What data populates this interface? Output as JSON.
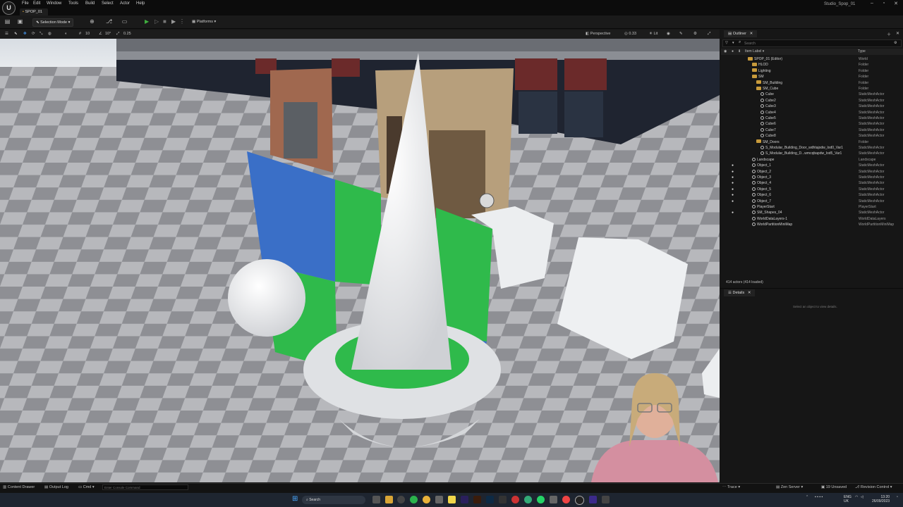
{
  "app": {
    "menu": [
      "File",
      "Edit",
      "Window",
      "Tools",
      "Build",
      "Select",
      "Actor",
      "Help"
    ],
    "project_title": "Studio_Spop_01",
    "level_tab": "SPOP_01"
  },
  "toolbar": {
    "selection_mode": "Selection Mode",
    "platforms": "Platforms"
  },
  "viewport": {
    "perspective": "Perspective",
    "fov_value": "0.33",
    "lit": "Lit",
    "grid_snap": "10",
    "rotation_snap": "10°",
    "scale_snap": "0.25"
  },
  "outliner": {
    "tab": "Outliner",
    "search_placeholder": "Search",
    "col_label": "Item Label ▾",
    "col_type": "Type",
    "rows": [
      {
        "label": "SPOP_01 (Editor)",
        "type": "World",
        "indent": 0,
        "kind": "world",
        "eye": false
      },
      {
        "label": "HLOD",
        "type": "Folder",
        "indent": 1,
        "kind": "folder",
        "eye": false
      },
      {
        "label": "Lighting",
        "type": "Folder",
        "indent": 1,
        "kind": "folder",
        "eye": false
      },
      {
        "label": "SM",
        "type": "Folder",
        "indent": 1,
        "kind": "folder",
        "eye": false
      },
      {
        "label": "SM_Building",
        "type": "Folder",
        "indent": 2,
        "kind": "folder",
        "eye": false
      },
      {
        "label": "SM_Cube",
        "type": "Folder",
        "indent": 2,
        "kind": "folder",
        "eye": false
      },
      {
        "label": "Cube",
        "type": "StaticMeshActor",
        "indent": 3,
        "kind": "mesh",
        "eye": false
      },
      {
        "label": "Cube2",
        "type": "StaticMeshActor",
        "indent": 3,
        "kind": "mesh",
        "eye": false
      },
      {
        "label": "Cube3",
        "type": "StaticMeshActor",
        "indent": 3,
        "kind": "mesh",
        "eye": false
      },
      {
        "label": "Cube4",
        "type": "StaticMeshActor",
        "indent": 3,
        "kind": "mesh",
        "eye": false
      },
      {
        "label": "Cube5",
        "type": "StaticMeshActor",
        "indent": 3,
        "kind": "mesh",
        "eye": false
      },
      {
        "label": "Cube6",
        "type": "StaticMeshActor",
        "indent": 3,
        "kind": "mesh",
        "eye": false
      },
      {
        "label": "Cube7",
        "type": "StaticMeshActor",
        "indent": 3,
        "kind": "mesh",
        "eye": false
      },
      {
        "label": "Cube8",
        "type": "StaticMeshActor",
        "indent": 3,
        "kind": "mesh",
        "eye": false
      },
      {
        "label": "SM_Doors",
        "type": "Folder",
        "indent": 2,
        "kind": "folder",
        "eye": false
      },
      {
        "label": "S_Modular_Building_Door_wdhtajodw_lod0_Var1",
        "type": "StaticMeshActor",
        "indent": 3,
        "kind": "mesh",
        "eye": false
      },
      {
        "label": "S_Modular_Building_D...wmcqbapdw_lod5_Var1",
        "type": "StaticMeshActor",
        "indent": 3,
        "kind": "mesh",
        "eye": false
      },
      {
        "label": "Landscape",
        "type": "Landscape",
        "indent": 1,
        "kind": "mesh",
        "eye": false
      },
      {
        "label": "Object_1",
        "type": "StaticMeshActor",
        "indent": 1,
        "kind": "mesh",
        "eye": true
      },
      {
        "label": "Object_2",
        "type": "StaticMeshActor",
        "indent": 1,
        "kind": "mesh",
        "eye": true
      },
      {
        "label": "Object_3",
        "type": "StaticMeshActor",
        "indent": 1,
        "kind": "mesh",
        "eye": true
      },
      {
        "label": "Object_4",
        "type": "StaticMeshActor",
        "indent": 1,
        "kind": "mesh",
        "eye": true
      },
      {
        "label": "Object_5",
        "type": "StaticMeshActor",
        "indent": 1,
        "kind": "mesh",
        "eye": true
      },
      {
        "label": "Object_6",
        "type": "StaticMeshActor",
        "indent": 1,
        "kind": "mesh",
        "eye": true
      },
      {
        "label": "Object_7",
        "type": "StaticMeshActor",
        "indent": 1,
        "kind": "mesh",
        "eye": true
      },
      {
        "label": "PlayerStart",
        "type": "PlayerStart",
        "indent": 1,
        "kind": "mesh",
        "eye": false
      },
      {
        "label": "SM_Shapes_04",
        "type": "StaticMeshActor",
        "indent": 1,
        "kind": "mesh",
        "eye": true
      },
      {
        "label": "WorldDataLayers-1",
        "type": "WorldDataLayers",
        "indent": 1,
        "kind": "mesh",
        "eye": false
      },
      {
        "label": "WorldPartitionMiniMap",
        "type": "WorldPartitionMiniMap",
        "indent": 1,
        "kind": "mesh",
        "eye": false
      }
    ],
    "actor_count": "414 actors (414 loaded)"
  },
  "details": {
    "tab": "Details",
    "empty_text": "Select an object to view details."
  },
  "statusbar": {
    "content_drawer": "Content Drawer",
    "output_log": "Output Log",
    "cmd": "Cmd",
    "cmd_placeholder": "Enter Console Command",
    "trace": "Trace",
    "zen_server": "Zen Server",
    "unsaved": "19 Unsaved",
    "revision_control": "Revision Control"
  },
  "taskbar": {
    "search": "Search",
    "lang": "ENG",
    "region": "UK",
    "time": "13:20",
    "date": "26/09/2023"
  },
  "colors": {
    "accent": "#c79a3b",
    "play_green": "#3fae3f",
    "panel_bg": "#161616"
  }
}
